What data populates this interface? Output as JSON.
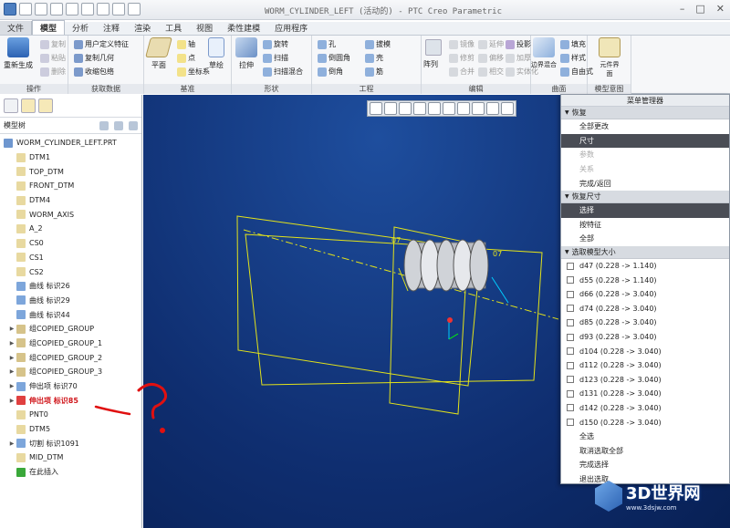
{
  "app": {
    "title": "WORM_CYLINDER_LEFT (活动的) - PTC Creo Parametric"
  },
  "tabs": [
    "文件",
    "模型",
    "分析",
    "注释",
    "渲染",
    "工具",
    "视图",
    "柔性建模",
    "应用程序"
  ],
  "ribbon": {
    "regen": "重新生成",
    "copy": "复制",
    "paste": "粘贴",
    "delete": "删除",
    "udf": "用户定义特征",
    "copy_geom": "复制几何",
    "shrinkwrap": "收缩包络",
    "plane": "平面",
    "axis": "轴",
    "point": "点",
    "csys": "坐标系",
    "sketch": "草绘",
    "extrude": "拉伸",
    "revolve": "旋转",
    "sweep": "扫描",
    "swept_blend": "扫描混合",
    "hole": "孔",
    "round": "倒圆角",
    "chamfer": "倒角",
    "draft": "拔模",
    "shell": "壳",
    "rib": "筋",
    "pattern": "阵列",
    "mirror": "镜像",
    "trim": "修剪",
    "merge": "合并",
    "extend": "延伸",
    "offset": "偏移",
    "intersect": "相交",
    "project": "投影",
    "thicken": "加厚",
    "solidify": "实体化",
    "boundary_blend": "边界混合",
    "fill": "填充",
    "style": "样式",
    "freestyle": "自由式",
    "component_interface": "元件界面",
    "groups": [
      "操作",
      "获取数据",
      "基准",
      "形状",
      "工程",
      "编辑",
      "曲面",
      "模型意图"
    ]
  },
  "model_tree": {
    "title": "模型树",
    "items": [
      {
        "label": "WORM_CYLINDER_LEFT.PRT",
        "icon": "part-icon",
        "expand": false
      },
      {
        "label": "DTM1",
        "icon": "datum-plane-icon",
        "expand": false
      },
      {
        "label": "TOP_DTM",
        "icon": "datum-plane-icon",
        "expand": false
      },
      {
        "label": "FRONT_DTM",
        "icon": "datum-plane-icon",
        "expand": false
      },
      {
        "label": "DTM4",
        "icon": "datum-plane-icon",
        "expand": false
      },
      {
        "label": "WORM_AXIS",
        "icon": "axis-icon",
        "expand": false
      },
      {
        "label": "A_2",
        "icon": "axis-icon",
        "expand": false
      },
      {
        "label": "CS0",
        "icon": "csys-icon",
        "expand": false
      },
      {
        "label": "CS1",
        "icon": "csys-icon",
        "expand": false
      },
      {
        "label": "CS2",
        "icon": "csys-icon",
        "expand": false
      },
      {
        "label": "曲线 标识26",
        "icon": "curve-icon",
        "expand": false
      },
      {
        "label": "曲线 标识29",
        "icon": "curve-icon",
        "expand": false
      },
      {
        "label": "曲线 标识44",
        "icon": "curve-icon",
        "expand": false
      },
      {
        "label": "组COPIED_GROUP",
        "icon": "group-icon",
        "expand": true
      },
      {
        "label": "组COPIED_GROUP_1",
        "icon": "group-icon",
        "expand": true
      },
      {
        "label": "组COPIED_GROUP_2",
        "icon": "group-icon",
        "expand": true
      },
      {
        "label": "组COPIED_GROUP_3",
        "icon": "group-icon",
        "expand": true
      },
      {
        "label": "伸出项 标识70",
        "icon": "protrusion-icon",
        "expand": true
      },
      {
        "label": "伸出项 标识85",
        "icon": "protrusion-icon",
        "expand": true,
        "error": true
      },
      {
        "label": "PNT0",
        "icon": "point-icon",
        "expand": false
      },
      {
        "label": "DTM5",
        "icon": "datum-plane-icon",
        "expand": false
      },
      {
        "label": "切割 标识1091",
        "icon": "cut-icon",
        "expand": true
      },
      {
        "label": "MID_DTM",
        "icon": "datum-plane-icon",
        "expand": false
      },
      {
        "label": "在此插入",
        "icon": "insert-icon",
        "expand": false
      }
    ]
  },
  "viewport": {
    "dim_labels": [
      "07",
      "07"
    ]
  },
  "menu_manager": {
    "title": "菜单管理器",
    "sec1": "恢复",
    "sec1_items": [
      {
        "label": "全部更改",
        "state": "normal"
      },
      {
        "label": "尺寸",
        "state": "selected"
      },
      {
        "label": "参数",
        "state": "disabled"
      },
      {
        "label": "关系",
        "state": "disabled"
      },
      {
        "label": "完成/返回",
        "state": "normal"
      }
    ],
    "sec2": "恢复尺寸",
    "sec2_items": [
      {
        "label": "选择",
        "state": "selected"
      },
      {
        "label": "按特征",
        "state": "normal"
      },
      {
        "label": "全部",
        "state": "normal"
      }
    ],
    "sec3": "选取模型大小",
    "dims": [
      "d47 (0.228 -> 1.140)",
      "d55 (0.228 -> 1.140)",
      "d66 (0.228 -> 3.040)",
      "d74 (0.228 -> 3.040)",
      "d85 (0.228 -> 3.040)",
      "d93 (0.228 -> 3.040)",
      "d104 (0.228 -> 3.040)",
      "d112 (0.228 -> 3.040)",
      "d123 (0.228 -> 3.040)",
      "d131 (0.228 -> 3.040)",
      "d142 (0.228 -> 3.040)",
      "d150 (0.228 -> 3.040)"
    ],
    "actions": [
      "全选",
      "取消选取全部",
      "完成选择",
      "退出选取"
    ]
  },
  "watermark": {
    "text": "3D世界网",
    "sub": "www.3dsjw.com"
  }
}
